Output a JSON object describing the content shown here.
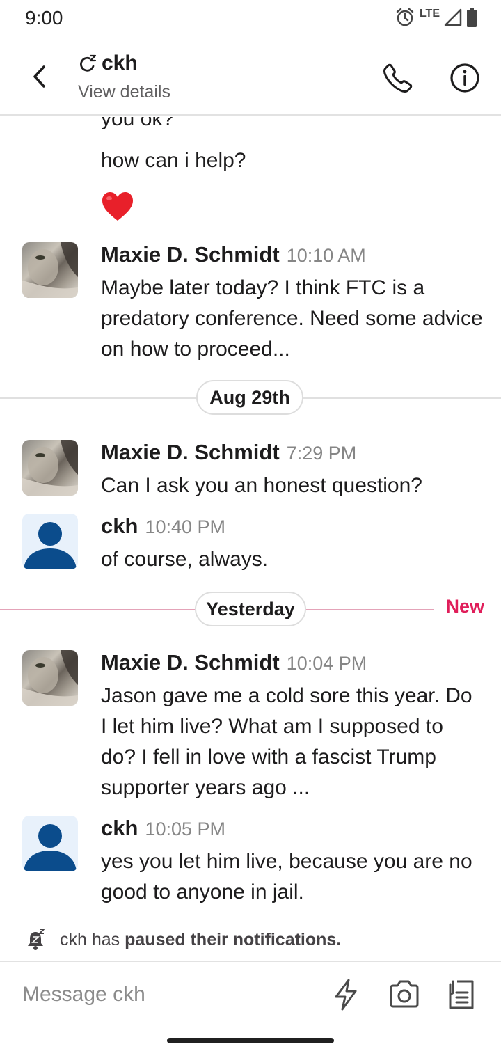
{
  "status_bar": {
    "time": "9:00",
    "network": "LTE",
    "battery_level": "100"
  },
  "header": {
    "title": "ckh",
    "subtitle": "View details",
    "status_icon": "snooze-icon"
  },
  "messages": {
    "continued_lines": [
      "you ok?",
      "how can i help?"
    ],
    "reaction": "red-heart-emoji",
    "items": [
      {
        "name": "Maxie D. Schmidt",
        "time": "10:10 AM",
        "avatar": "cat-photo",
        "text": "Maybe later today? I think FTC is a predatory conference. Need some advice on how to proceed..."
      },
      {
        "name": "Maxie D. Schmidt",
        "time": "7:29 PM",
        "avatar": "cat-photo",
        "text": "Can I ask you an honest question?"
      },
      {
        "name": "ckh",
        "time": "10:40 PM",
        "avatar": "default-user",
        "text": "of course, always."
      },
      {
        "name": "Maxie D. Schmidt",
        "time": "10:04 PM",
        "avatar": "cat-photo",
        "text": "Jason gave me a cold sore this year. Do I let him live? What am I supposed to do? I fell in love with a fascist Trump supporter years ago ..."
      },
      {
        "name": "ckh",
        "time": "10:05 PM",
        "avatar": "default-user",
        "text": "yes you let him live, because you are no good to anyone in jail."
      }
    ],
    "dividers": {
      "aug29": "Aug 29th",
      "yesterday": "Yesterday",
      "new_label": "New"
    }
  },
  "notification": {
    "prefix": "ckh has",
    "bold": "paused their notifications."
  },
  "composer": {
    "placeholder": "Message ckh"
  },
  "colors": {
    "accent_new": "#e01e5a",
    "user_avatar_blue": "#0b4c8c",
    "text_primary": "#1d1c1d",
    "text_muted": "#868686"
  }
}
